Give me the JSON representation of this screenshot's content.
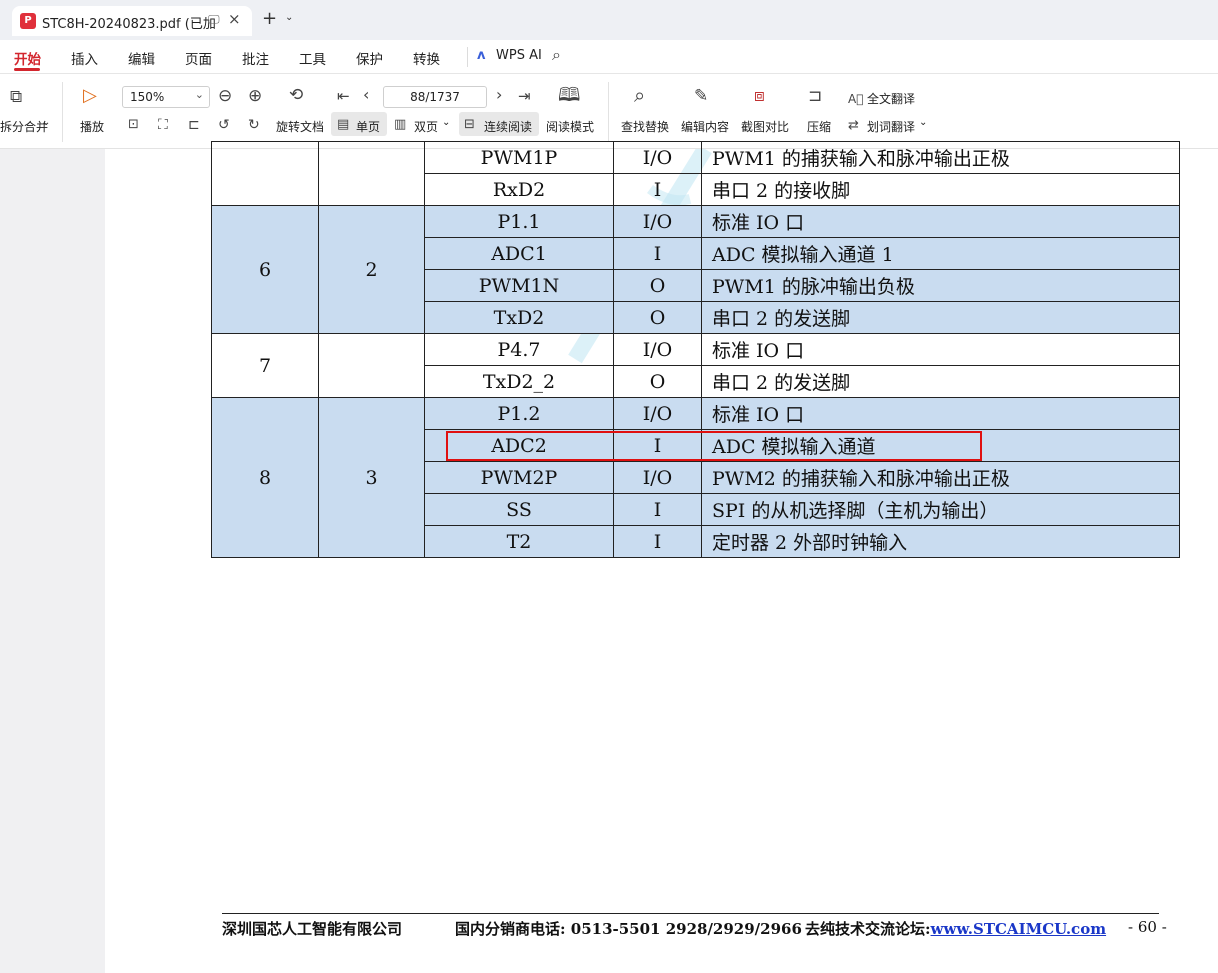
{
  "titlebar": {
    "tab_title": "STC8H-20240823.pdf (已加",
    "logo_glyph": "P",
    "new_tab": "+",
    "tab_menu": "⌄",
    "close": "×"
  },
  "menubar": {
    "items": [
      "开始",
      "插入",
      "编辑",
      "页面",
      "批注",
      "工具",
      "保护",
      "转换"
    ],
    "active_index": 0,
    "wps_ai": "WPS AI",
    "accent_color": "#d3262e"
  },
  "toolbar": {
    "split_merge": "拆分合并",
    "play": "播放",
    "zoom": "150%",
    "rotate": "旋转文档",
    "single_page": "单页",
    "double_page": "双页",
    "continuous": "连续阅读",
    "read_mode": "阅读模式",
    "page_indicator": "88/1737",
    "find_replace": "查找替换",
    "edit_content": "编辑内容",
    "screenshot_compare": "截图对比",
    "compress": "压缩",
    "full_translate": "全文翻译",
    "word_translate": "划词翻译"
  },
  "table": {
    "rows": [
      {
        "pin": "",
        "idx": "",
        "name": "PWM1P",
        "type": "I/O",
        "desc": "PWM1 的捕获输入和脉冲输出正极",
        "blue": false
      },
      {
        "name": "RxD2",
        "type": "I",
        "desc": "串口 2 的接收脚",
        "blue": false
      },
      {
        "pin": "6",
        "idx": "2",
        "name": "P1.1",
        "type": "I/O",
        "desc": "标准 IO 口",
        "blue": true
      },
      {
        "name": "ADC1",
        "type": "I",
        "desc": "ADC 模拟输入通道 1",
        "blue": true
      },
      {
        "name": "PWM1N",
        "type": "O",
        "desc": "PWM1 的脉冲输出负极",
        "blue": true
      },
      {
        "name": "TxD2",
        "type": "O",
        "desc": "串口 2 的发送脚",
        "blue": true
      },
      {
        "pin": "7",
        "idx": "",
        "name": "P4.7",
        "type": "I/O",
        "desc": "标准 IO 口",
        "blue": false
      },
      {
        "name": "TxD2_2",
        "type": "O",
        "desc": "串口 2 的发送脚",
        "blue": false
      },
      {
        "pin": "8",
        "idx": "3",
        "name": "P1.2",
        "type": "I/O",
        "desc": "标准 IO 口",
        "blue": true
      },
      {
        "name": "ADC2",
        "type": "I",
        "desc": "ADC 模拟输入通道",
        "blue": true
      },
      {
        "name": "PWM2P",
        "type": "I/O",
        "desc": "PWM2 的捕获输入和脉冲输出正极",
        "blue": true
      },
      {
        "name": "SS",
        "type": "I",
        "desc": "SPI 的从机选择脚（主机为输出）",
        "blue": true
      },
      {
        "name": "T2",
        "type": "I",
        "desc": "定时器 2 外部时钟输入",
        "blue": true
      }
    ],
    "cell_blue": "#c9dcf0",
    "highlight_color": "#e01010"
  },
  "footer": {
    "company": "深圳国芯人工智能有限公司",
    "phone": "国内分销商电话: 0513-5501 2928/2929/2966",
    "forum_label": "去纯技术交流论坛:",
    "forum_link": "www.STCAIMCU.com",
    "page_number": "- 60 -"
  }
}
